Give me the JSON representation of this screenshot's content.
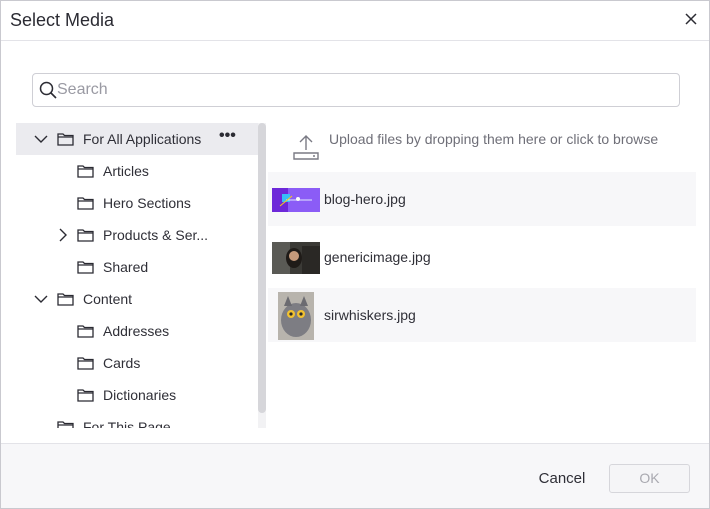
{
  "dialog": {
    "title": "Select Media"
  },
  "search": {
    "placeholder": "Search",
    "value": ""
  },
  "tree": {
    "items": [
      {
        "label": "For All Applications",
        "level": 0,
        "expanded": true,
        "selected": true,
        "has_menu": true
      },
      {
        "label": "Articles",
        "level": 1
      },
      {
        "label": "Hero Sections",
        "level": 1
      },
      {
        "label": "Products & Ser...",
        "level": 1,
        "expandable": true,
        "expanded": false
      },
      {
        "label": "Shared",
        "level": 1
      },
      {
        "label": "Content",
        "level": 0,
        "expanded": true
      },
      {
        "label": "Addresses",
        "level": 1
      },
      {
        "label": "Cards",
        "level": 1
      },
      {
        "label": "Dictionaries",
        "level": 1
      },
      {
        "label": "For This Page",
        "level": 0
      }
    ],
    "more_label": "•••"
  },
  "upload": {
    "text": "Upload files by dropping them here or click to browse"
  },
  "files": [
    {
      "name": "blog-hero.jpg"
    },
    {
      "name": "genericimage.jpg"
    },
    {
      "name": "sirwhiskers.jpg"
    }
  ],
  "footer": {
    "cancel_label": "Cancel",
    "ok_label": "OK"
  },
  "colors": {
    "selected_row": "#ebebef",
    "alt_row": "#f7f7f9",
    "muted_text": "#6f6f78"
  }
}
